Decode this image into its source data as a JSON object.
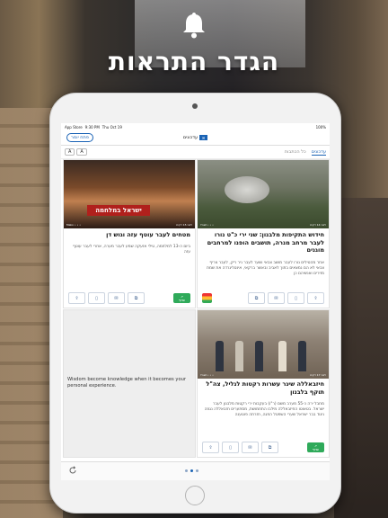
{
  "promo": {
    "headline": "הגדר התראות"
  },
  "status_bar": {
    "carrier": "App Store",
    "time": "9:30 PM",
    "date": "Thu Oct 19",
    "battery": "100%"
  },
  "nav": {
    "alerts_label": "פתח יומר",
    "logo_text": "עדכונים"
  },
  "tabs": [
    {
      "label": "עדכונים",
      "active": true
    },
    {
      "label": "כל הכתבות",
      "active": false
    }
  ],
  "font_buttons": {
    "large": "A",
    "small": "A"
  },
  "cards": [
    {
      "title": "חידוש התקיפות מלבנון: שני ירי כ\"ט נורו לעבר מרחב מנרה, תושבים הופנו למרחבים מוגנים",
      "body": "אחר מהטילים נורו לעבר מושב צבאי ושער לעבר ניר ריק, לעבר צריף צבאי לא הם נמצאים בתוך לאביב ובאשר ברקאי, אינטליגרדה את שמת מזירים ואנשיהם כן",
      "meta_left": "Ynet • • •",
      "meta_right": "לפני 14 דקות"
    },
    {
      "title": "מטחים לעבר עוטף עזה וגוש דן",
      "body": "ביום ה-13 למלחמה, טילי אזעקה שמע לעבר מערה, אחרי לעבר עוטף עזה",
      "banner": "ישראל במלחמה",
      "meta_left": "Mako • • •",
      "meta_right": "לפני 15 דקות"
    },
    {
      "title": "חיזבאללה שיגר עשרות רקטות לגליל, צה\"ל תוקף בלבנון",
      "body": "מחבל ירה כ-55 מערב משם (ר\"ו) בעקבות ירי רקטות מלבנון לעבר ישראל. בטאוטו החיזבאללה מילבו התחמושת, מסתערים חזבאללה נגוזה ניגוד בבר ישראל שערי השפטל הפגה, חזרתה פוטענה",
      "meta_left": "Ynet • • •",
      "meta_right": "לפני 17 דקות"
    }
  ],
  "share_label": "שתף",
  "wisdom_text": "Wisdom become knowledge when it becomes your personal experience.",
  "pager": {
    "pages": 3,
    "current": 1
  }
}
